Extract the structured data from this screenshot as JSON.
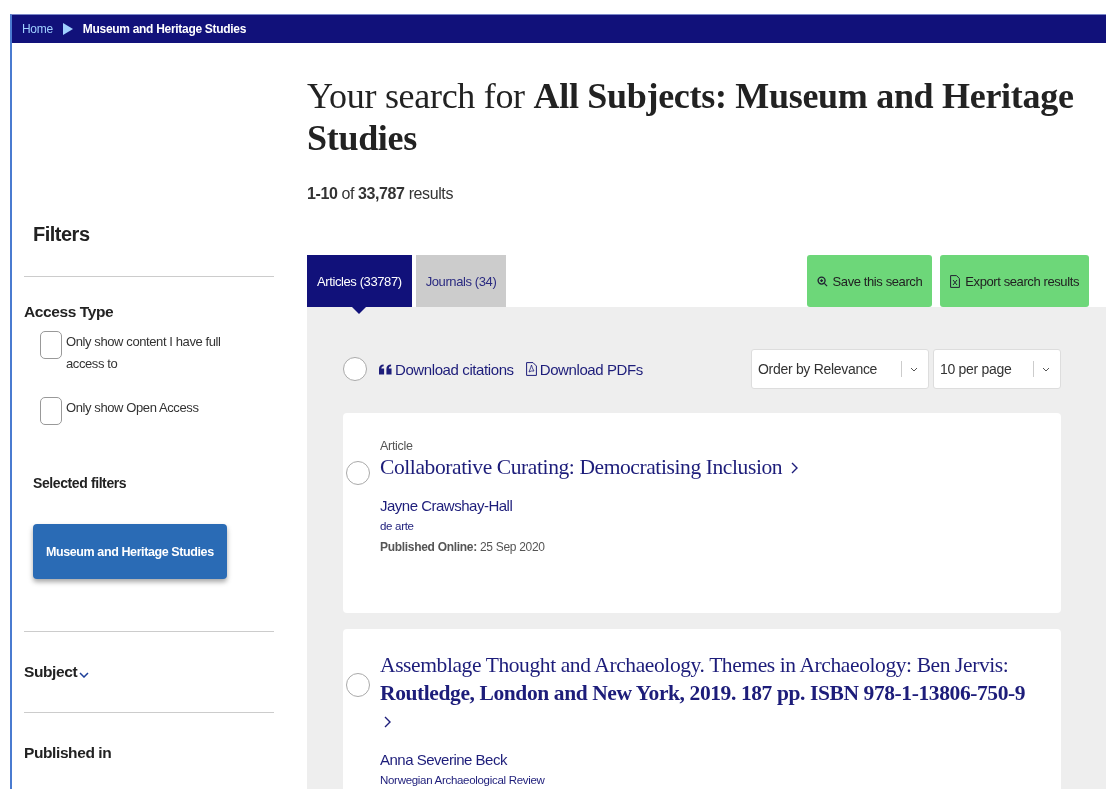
{
  "breadcrumb": [
    {
      "label": "Home",
      "current": false
    },
    {
      "label": "Museum and Heritage Studies",
      "current": true
    }
  ],
  "sidebar": {
    "heading": "Filters",
    "access_type": {
      "heading": "Access Type",
      "options": [
        {
          "label": "Only show content I have full access to",
          "checked": false
        },
        {
          "label": "Only show Open Access",
          "checked": false
        }
      ]
    },
    "selected_filters": {
      "heading": "Selected filters",
      "chips": [
        "Museum and Heritage Studies"
      ]
    },
    "sections": [
      {
        "label": "Subject",
        "expandable": true
      },
      {
        "label": "Published in",
        "expandable": false
      }
    ]
  },
  "search": {
    "title": "Your search for **All Subjects: Museum and Heritage Studies**",
    "count": "**1-10** of **33,787** results"
  },
  "tabs": [
    {
      "label": "Articles (33787)",
      "selected": true
    },
    {
      "label": "Journals (34)",
      "selected": false
    }
  ],
  "actions": [
    {
      "kind": "save",
      "label": "Save this search"
    },
    {
      "kind": "export",
      "label": "Export search results"
    }
  ],
  "toolbar": {
    "select_all": {
      "selected": false
    },
    "links": [
      {
        "kind": "citations",
        "label": "Download citations"
      },
      {
        "kind": "pdf",
        "label": "Download PDFs"
      }
    ],
    "dropdowns": [
      {
        "value": "Order by Relevance"
      },
      {
        "value": "10 per page"
      }
    ]
  },
  "results": [
    {
      "selected": false,
      "type": "Article",
      "title": "Collaborative Curating: Democratising Inclusion",
      "author": "Jayne Crawshay-Hall",
      "journal": "de arte",
      "published_label": "Published Online:",
      "published_date": "25 Sep 2020"
    },
    {
      "selected": false,
      "title": "Assemblage Thought and Archaeology. Themes in Archaeology: Ben Jervis: **Routledge, London and New York, 2019. 187 pp. ISBN 978-1-13806-750-9**",
      "author": "Anna Severine Beck",
      "journal": "Norwegian Archaeological Review"
    }
  ]
}
